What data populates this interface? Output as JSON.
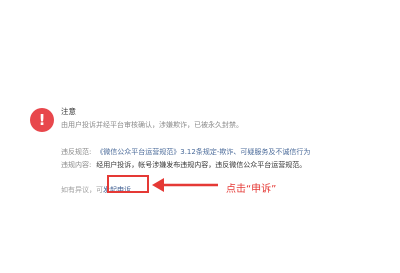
{
  "notice": {
    "icon_symbol": "!",
    "title": "注意",
    "description": "由用户投诉并经平台审核确认，涉嫌欺诈，已被永久封禁。"
  },
  "violation": {
    "rule_label": "违反规范:",
    "rule_text": "《微信公众平台运营规范》3.12条规定-欺诈、可疑服务及不诚信行为",
    "content_label": "违规内容:",
    "content_text": "经用户投诉，帐号涉嫌发布违规内容，违反微信公众平台运营规范。"
  },
  "appeal": {
    "prefix": "如有异议，可",
    "link_text": "发起申诉"
  },
  "annotation": {
    "text": "点击“申诉”"
  },
  "colors": {
    "warning": "#e8474c",
    "annotation_red": "#e53935",
    "link_blue": "#4a6a99"
  }
}
